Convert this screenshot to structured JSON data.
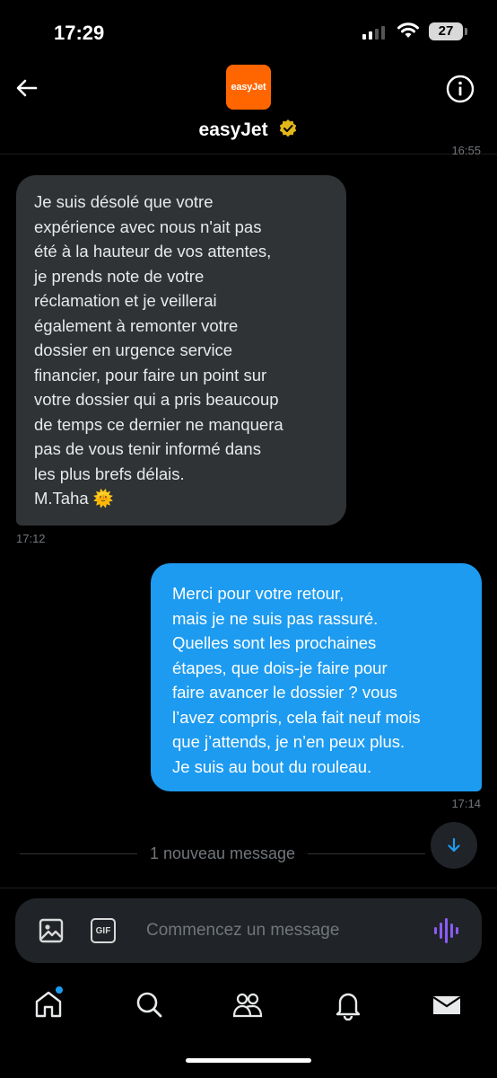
{
  "status_bar": {
    "time": "17:29",
    "battery": "27",
    "icons": [
      "signal-icon",
      "wifi-icon",
      "battery-icon"
    ]
  },
  "header": {
    "avatar_text": "easyJet",
    "name": "easyJet",
    "verified": true,
    "partial_timestamp": "16:55",
    "icons": [
      "back-arrow-icon",
      "info-icon",
      "verified-badge-icon"
    ]
  },
  "messages": [
    {
      "direction": "incoming",
      "text": "Je suis désolé que votre\nexpérience avec nous n'ait pas\nété à la hauteur de vos attentes,\nje prends note de votre\nréclamation et je veillerai\négalement à remonter votre\ndossier en urgence  service\nfinancier, pour faire un point sur\nvotre dossier qui a pris beaucoup\nde temps ce dernier ne manquera\npas de vous tenir informé dans\nles plus brefs délais.\nM.Taha 🌞",
      "time": "17:12"
    },
    {
      "direction": "outgoing",
      "text": "Merci pour votre retour,\nmais je ne suis pas rassuré.\nQuelles sont les prochaines\nétapes, que dois-je faire pour\nfaire avancer le dossier ? vous\nl’avez compris, cela fait neuf mois\nque j’attends, je n’en peux plus.\nJe suis au bout du rouleau.",
      "time": "17:14"
    }
  ],
  "new_message_divider": "1 nouveau message",
  "composer": {
    "placeholder": "Commencez un message",
    "gif_label": "GIF",
    "icons": [
      "image-icon",
      "gif-icon",
      "voice-message-icon"
    ]
  },
  "tab_bar": {
    "tabs": [
      "home",
      "search",
      "communities",
      "notifications",
      "messages"
    ],
    "home_has_notification_dot": true
  },
  "colors": {
    "accent": "#1d9bf0",
    "incoming_bubble": "#2f3336",
    "brand_orange": "#ff6600",
    "verified_gold": "#e2b719",
    "voice_purple": "#8b5cf6"
  }
}
